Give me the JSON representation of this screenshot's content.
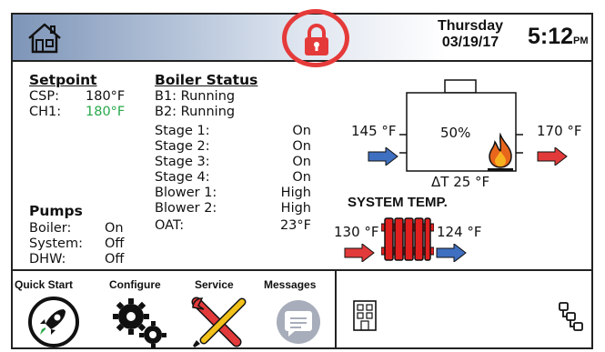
{
  "header": {
    "home_icon": "home-icon",
    "lock_icon": "lock-icon",
    "day": "Thursday",
    "date": "03/19/17",
    "time": "5:12",
    "ampm": "PM",
    "lock_color": "#e53a3a"
  },
  "setpoint": {
    "title": "Setpoint",
    "csp_label": "CSP:",
    "csp_value": "180°F",
    "ch1_label": "CH1:",
    "ch1_value": "180°F",
    "ch1_color": "#27a84a"
  },
  "pumps": {
    "title": "Pumps",
    "rows": [
      {
        "label": "Boiler:",
        "value": "On"
      },
      {
        "label": "System:",
        "value": "Off"
      },
      {
        "label": "DHW:",
        "value": "Off"
      }
    ]
  },
  "boiler_status": {
    "title": "Boiler Status",
    "b1": "B1: Running",
    "b2": "B2: Running",
    "rows": [
      {
        "label": "Stage 1:",
        "value": "On"
      },
      {
        "label": "Stage 2:",
        "value": "On"
      },
      {
        "label": "Stage 3:",
        "value": "On"
      },
      {
        "label": "Stage 4:",
        "value": "On"
      },
      {
        "label": "Blower 1:",
        "value": "High"
      },
      {
        "label": "Blower 2:",
        "value": "High"
      },
      {
        "label": "OAT:",
        "value": "23°F"
      }
    ]
  },
  "boiler_diagram": {
    "inlet_temp": "145 °F",
    "firing_rate": "50%",
    "outlet_temp": "170 °F",
    "delta_t": "ΔT 25 °F",
    "flame_icon": "flame-icon"
  },
  "system_temp": {
    "title": "SYSTEM TEMP.",
    "supply_temp": "130 °F",
    "return_temp": "124 °F",
    "radiator_icon": "radiator-icon"
  },
  "nav": {
    "quick_start": "Quick Start",
    "configure": "Configure",
    "service": "Service",
    "messages": "Messages",
    "building_icon": "building-icon",
    "network_icon": "network-icon"
  },
  "colors": {
    "arrow_blue": "#3f6fc0",
    "arrow_red": "#e23a3a",
    "radiator_red": "#e01f1f"
  }
}
